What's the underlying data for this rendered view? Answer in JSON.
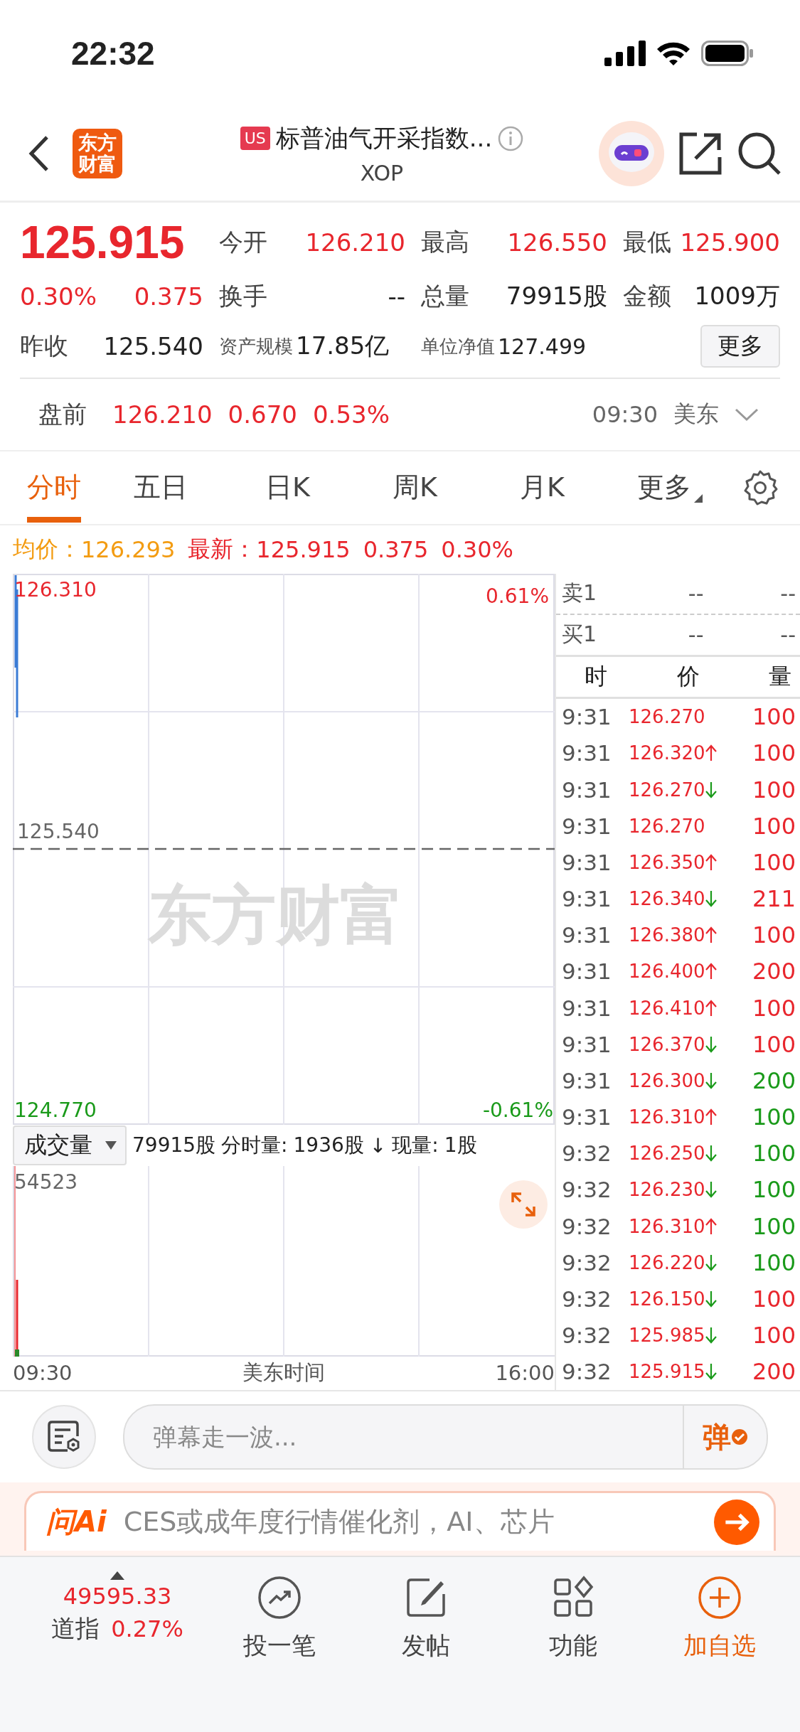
{
  "status_bar": {
    "time": "22:32"
  },
  "header": {
    "logo_lines": [
      "东方",
      "财富"
    ],
    "market_badge": "US",
    "title": "标普油气开采指数...",
    "subtitle": "XOP"
  },
  "quote": {
    "price": "125.915",
    "change_pct": "0.30%",
    "change": "0.375",
    "rows": [
      [
        {
          "label": "今开",
          "value": "126.210",
          "kind": "up"
        },
        {
          "label": "最高",
          "value": "126.550",
          "kind": "up"
        },
        {
          "label": "最低",
          "value": "125.900",
          "kind": "up"
        }
      ],
      [
        {
          "label": "换手",
          "value": "--",
          "kind": "plain"
        },
        {
          "label": "总量",
          "value": "79915股",
          "kind": "plain"
        },
        {
          "label": "金额",
          "value": "1009万",
          "kind": "plain"
        }
      ]
    ],
    "prev_close": {
      "label": "昨收",
      "value": "125.540"
    },
    "asset_size": {
      "label": "资产规模",
      "value": "17.85亿"
    },
    "nav": {
      "label": "单位净值",
      "value": "127.499"
    },
    "more_button": "更多"
  },
  "premarket": {
    "label": "盘前",
    "price": "126.210",
    "change": "0.670",
    "change_pct": "0.53%",
    "time": "09:30",
    "zone": "美东"
  },
  "tabs": [
    {
      "label": "分时",
      "selected": true,
      "kind": "plain"
    },
    {
      "label": "五日",
      "selected": false,
      "kind": "plain"
    },
    {
      "label": "日K",
      "selected": false,
      "kind": "plain"
    },
    {
      "label": "周K",
      "selected": false,
      "kind": "plain"
    },
    {
      "label": "月K",
      "selected": false,
      "kind": "plain"
    },
    {
      "label": "更多",
      "selected": false,
      "kind": "dropdown"
    }
  ],
  "info_line": {
    "avg_label": "均价：",
    "avg": "126.293",
    "latest_label": "最新：",
    "latest": "125.915",
    "change": "0.375",
    "change_pct": "0.30%"
  },
  "price_chart": {
    "top_price": "126.310",
    "mid_price": "125.540",
    "bottom_price": "124.770",
    "top_pct": "0.61%",
    "bottom_pct": "-0.61%",
    "watermark": "东方财富"
  },
  "volume_chart": {
    "selector": "成交量",
    "total": "79915股",
    "period_label": "分时量:",
    "period_value": "1936股",
    "period_arrow": "↓",
    "current_label": "现量:",
    "current_value": "1股",
    "max": "54523",
    "x_start": "09:30",
    "x_label": "美东时间",
    "x_end": "16:00"
  },
  "order_book": [
    {
      "label": "卖1",
      "price": "--",
      "volume": "--"
    },
    {
      "label": "买1",
      "price": "--",
      "volume": "--"
    }
  ],
  "trades_header": [
    "时",
    "价",
    "量"
  ],
  "trades": [
    {
      "time": "9:31",
      "price": "126.270",
      "kind": "flat",
      "volume": "100",
      "color": "#e8262d"
    },
    {
      "time": "9:31",
      "price": "126.320",
      "kind": "up",
      "volume": "100",
      "color": "#e8262d"
    },
    {
      "time": "9:31",
      "price": "126.270",
      "kind": "down",
      "volume": "100",
      "color": "#e8262d"
    },
    {
      "time": "9:31",
      "price": "126.270",
      "kind": "flat",
      "volume": "100",
      "color": "#e8262d"
    },
    {
      "time": "9:31",
      "price": "126.350",
      "kind": "up",
      "volume": "100",
      "color": "#e8262d"
    },
    {
      "time": "9:31",
      "price": "126.340",
      "kind": "down",
      "volume": "211",
      "color": "#e8262d"
    },
    {
      "time": "9:31",
      "price": "126.380",
      "kind": "up",
      "volume": "100",
      "color": "#e8262d"
    },
    {
      "time": "9:31",
      "price": "126.400",
      "kind": "up",
      "volume": "200",
      "color": "#e8262d"
    },
    {
      "time": "9:31",
      "price": "126.410",
      "kind": "up",
      "volume": "100",
      "color": "#e8262d"
    },
    {
      "time": "9:31",
      "price": "126.370",
      "kind": "down",
      "volume": "100",
      "color": "#e8262d"
    },
    {
      "time": "9:31",
      "price": "126.300",
      "kind": "down",
      "volume": "200",
      "color": "#1a9a1a"
    },
    {
      "time": "9:31",
      "price": "126.310",
      "kind": "up",
      "volume": "100",
      "color": "#1a9a1a"
    },
    {
      "time": "9:32",
      "price": "126.250",
      "kind": "down",
      "volume": "100",
      "color": "#1a9a1a"
    },
    {
      "time": "9:32",
      "price": "126.230",
      "kind": "down",
      "volume": "100",
      "color": "#1a9a1a"
    },
    {
      "time": "9:32",
      "price": "126.310",
      "kind": "up",
      "volume": "100",
      "color": "#1a9a1a"
    },
    {
      "time": "9:32",
      "price": "126.220",
      "kind": "down",
      "volume": "100",
      "color": "#1a9a1a"
    },
    {
      "time": "9:32",
      "price": "126.150",
      "kind": "down",
      "volume": "100",
      "color": "#e8262d"
    },
    {
      "time": "9:32",
      "price": "125.985",
      "kind": "down",
      "volume": "100",
      "color": "#e8262d"
    },
    {
      "time": "9:32",
      "price": "125.915",
      "kind": "down",
      "volume": "200",
      "color": "#e8262d"
    }
  ],
  "comment_bar": {
    "placeholder": "弹幕走一波...",
    "send": "弹"
  },
  "banner": {
    "brand": "问Ai",
    "text": "CES或成年度行情催化剂，AI、芯片"
  },
  "bottom_bar": {
    "index_value": "49595.33",
    "index_name": "道指",
    "index_pct": "0.27%",
    "actions": [
      {
        "label": "投一笔",
        "kind": "trend"
      },
      {
        "label": "发帖",
        "kind": "edit"
      },
      {
        "label": "功能",
        "kind": "apps"
      },
      {
        "label": "加自选",
        "kind": "add"
      }
    ]
  }
}
